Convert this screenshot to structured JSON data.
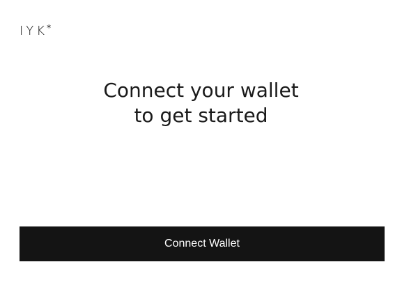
{
  "brand": {
    "logo_text": "IYK",
    "logo_mark": "*"
  },
  "main": {
    "headline_line1": "Connect your wallet",
    "headline_line2": "to get started"
  },
  "actions": {
    "connect_label": "Connect Wallet"
  },
  "colors": {
    "background": "#ffffff",
    "button_background": "#141414",
    "button_text": "#ffffff",
    "text": "#1a1a1a"
  }
}
